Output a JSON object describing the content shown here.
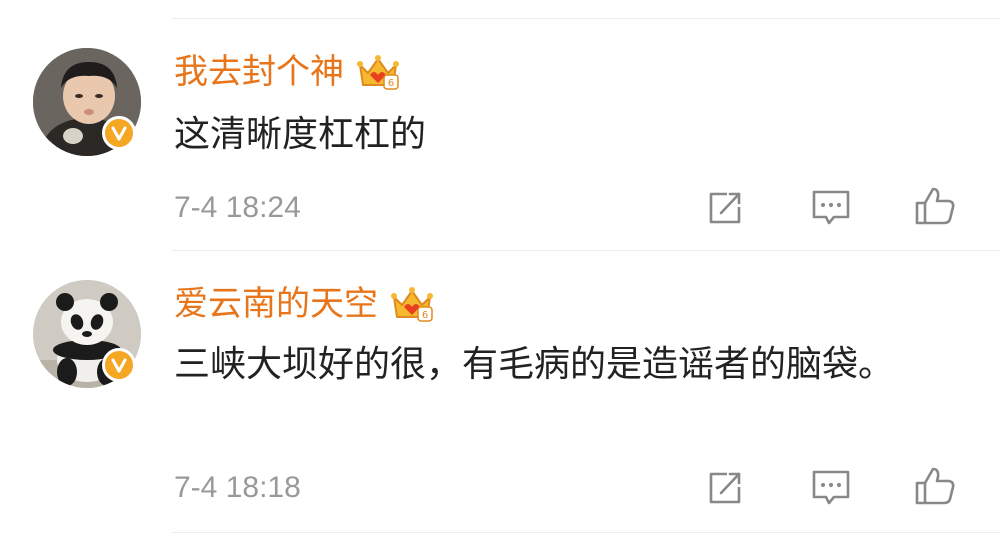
{
  "comments": [
    {
      "username": "我去封个神",
      "text": "这清晰度杠杠的",
      "time": "7-4 18:24",
      "level": "6",
      "avatar": "child-avatar"
    },
    {
      "username": "爱云南的天空",
      "text": "三峡大坝好的很，有毛病的是造谣者的脑袋。",
      "time": "7-4 18:18",
      "level": "6",
      "avatar": "panda-avatar"
    }
  ],
  "colors": {
    "username": "#e8751a",
    "text": "#222222",
    "time": "#999999",
    "verified_badge": "#f5a623",
    "icon": "#888888",
    "divider": "#ececec"
  },
  "icons": {
    "repost": "repost-icon",
    "comment": "comment-icon",
    "like": "like-icon",
    "verified": "verified-badge-icon",
    "member": "crown-member-icon"
  }
}
